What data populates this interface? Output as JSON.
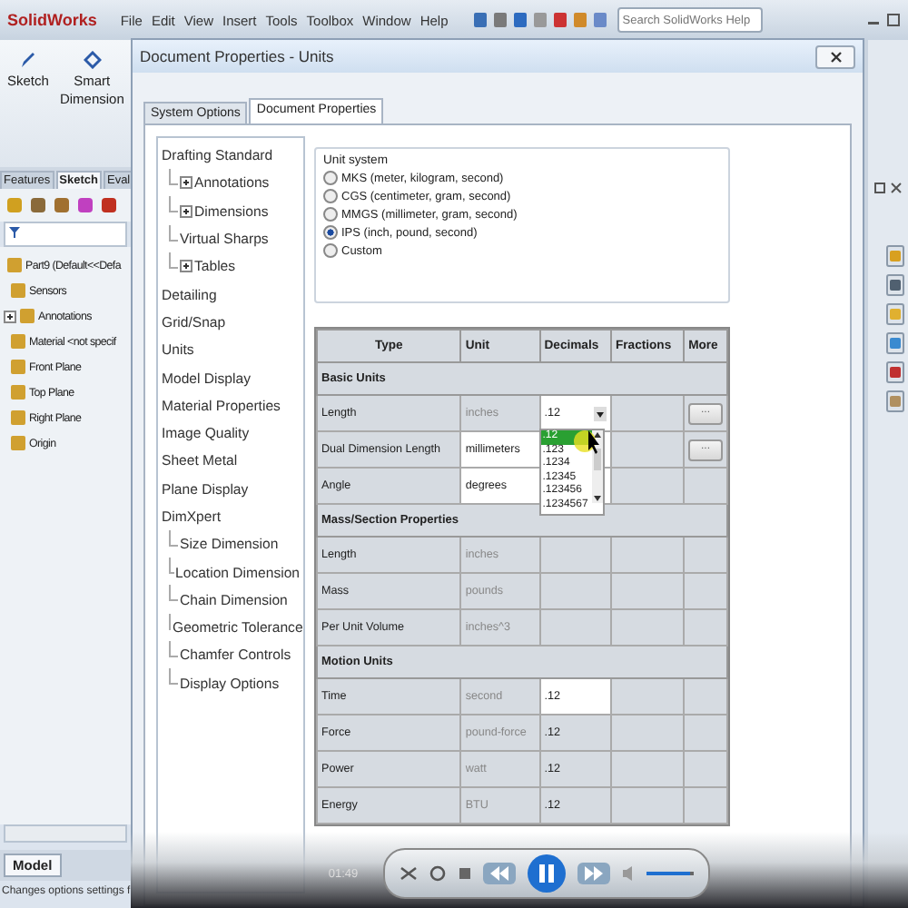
{
  "app": {
    "logo": "SolidWorks",
    "menu": [
      "File",
      "Edit",
      "View",
      "Insert",
      "Tools",
      "Toolbox",
      "Window",
      "Help"
    ],
    "search": {
      "placeholder": "Search SolidWorks Help"
    }
  },
  "command_manager": {
    "buttons": [
      "Sketch",
      "Smart\nDimension"
    ],
    "tabs": [
      {
        "label": "Features",
        "selected": false
      },
      {
        "label": "Sketch",
        "selected": true
      },
      {
        "label": "Eval",
        "selected": false
      }
    ]
  },
  "feature_tree": [
    {
      "label": "Part9  (Default<<Defa",
      "expandable": false,
      "children": [
        {
          "label": "Sensors",
          "expandable": false
        },
        {
          "label": "Annotations",
          "expandable": true
        },
        {
          "label": "Material <not specif",
          "expandable": false
        },
        {
          "label": "Front Plane",
          "expandable": false
        },
        {
          "label": "Top Plane",
          "expandable": false
        },
        {
          "label": "Right Plane",
          "expandable": false
        },
        {
          "label": "Origin",
          "expandable": false
        }
      ]
    }
  ],
  "bottom_tabs": [
    {
      "label": "Model",
      "selected": true
    }
  ],
  "status_bar": "Changes options settings f",
  "dialog": {
    "title": "Document Properties - Units",
    "tabs": [
      {
        "label": "System Options",
        "selected": false
      },
      {
        "label": "Document Properties",
        "selected": true
      }
    ],
    "tree": [
      {
        "label": "Drafting Standard",
        "expandable": false,
        "children": [
          {
            "label": "Annotations",
            "expandable": true
          },
          {
            "label": "Dimensions",
            "expandable": true
          },
          {
            "label": "Virtual Sharps",
            "expandable": false
          },
          {
            "label": "Tables",
            "expandable": true
          }
        ]
      },
      {
        "label": "Detailing",
        "expandable": false
      },
      {
        "label": "Grid/Snap",
        "expandable": false
      },
      {
        "label": "Units",
        "expandable": false
      },
      {
        "label": "Model Display",
        "expandable": false
      },
      {
        "label": "Material Properties",
        "expandable": false
      },
      {
        "label": "Image Quality",
        "expandable": false
      },
      {
        "label": "Sheet Metal",
        "expandable": false
      },
      {
        "label": "Plane Display",
        "expandable": false
      },
      {
        "label": "DimXpert",
        "expandable": false,
        "children": [
          {
            "label": "Size Dimension",
            "expandable": false
          },
          {
            "label": "Location Dimension",
            "expandable": false
          },
          {
            "label": "Chain Dimension",
            "expandable": false
          },
          {
            "label": "Geometric Tolerance",
            "expandable": false
          },
          {
            "label": "Chamfer Controls",
            "expandable": false
          },
          {
            "label": "Display Options",
            "expandable": false
          }
        ]
      }
    ],
    "unit_system": {
      "title": "Unit system",
      "options": [
        {
          "label": "MKS  (meter, kilogram, second)",
          "selected": false
        },
        {
          "label": "CGS  (centimeter, gram, second)",
          "selected": false
        },
        {
          "label": "MMGS  (millimeter, gram, second)",
          "selected": false
        },
        {
          "label": "IPS  (inch, pound, second)",
          "selected": true
        },
        {
          "label": "Custom",
          "selected": false
        }
      ]
    },
    "table": {
      "columns": [
        "Type",
        "Unit",
        "Decimals",
        "Fractions",
        "More"
      ],
      "sections": [
        {
          "title": "Basic Units",
          "rows": [
            {
              "type": "Length",
              "unit": "inches",
              "unit_editable": false,
              "decimals": ".12",
              "decimals_editable": true,
              "dropdown": true,
              "more_button": "..."
            },
            {
              "type": "Dual Dimension Length",
              "unit": "millimeters",
              "unit_editable": true,
              "decimals_editable": true,
              "dropdown": false,
              "more_button": "..."
            },
            {
              "type": "Angle",
              "unit": "degrees",
              "unit_editable": true,
              "decimals_editable": true,
              "dropdown": false
            }
          ]
        },
        {
          "title": "Mass/Section Properties",
          "rows": [
            {
              "type": "Length",
              "unit": "inches",
              "unit_editable": false,
              "decimals_editable": false,
              "dropdown": false
            },
            {
              "type": "Mass",
              "unit": "pounds",
              "unit_editable": false,
              "decimals_editable": false,
              "dropdown": false
            },
            {
              "type": "Per Unit Volume",
              "unit": "inches^3",
              "unit_editable": false,
              "decimals_editable": false,
              "dropdown": false
            }
          ]
        },
        {
          "title": "Motion Units",
          "rows": [
            {
              "type": "Time",
              "unit": "second",
              "unit_editable": false,
              "decimals": ".12",
              "decimals_editable": true,
              "dropdown": false
            },
            {
              "type": "Force",
              "unit": "pound-force",
              "unit_editable": false,
              "decimals": ".12",
              "decimals_editable": false,
              "dropdown": false
            },
            {
              "type": "Power",
              "unit": "watt",
              "unit_editable": false,
              "decimals": ".12",
              "decimals_editable": false,
              "dropdown": false
            },
            {
              "type": "Energy",
              "unit": "BTU",
              "unit_editable": false,
              "decimals": ".12",
              "decimals_editable": false,
              "dropdown": false
            }
          ]
        }
      ]
    },
    "decimals_list": {
      "options": [
        {
          "label": ".12",
          "selected": true
        },
        {
          "label": ".123",
          "selected": false
        },
        {
          "label": ".1234",
          "selected": false
        },
        {
          "label": ".12345",
          "selected": false
        },
        {
          "label": ".123456",
          "selected": false
        },
        {
          "label": ".1234567",
          "selected": false
        }
      ]
    }
  },
  "media_player": {
    "time": "01:49",
    "volume": {
      "level": 0.9
    }
  }
}
